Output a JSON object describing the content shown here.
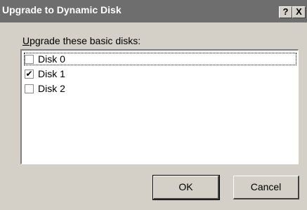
{
  "window": {
    "title": "Upgrade to Dynamic Disk",
    "help_label": "?",
    "close_label": "X"
  },
  "list": {
    "label_accel": "U",
    "label_rest": "pgrade these basic disks:",
    "items": [
      {
        "label": "Disk 0",
        "checked": false,
        "check_mark": ""
      },
      {
        "label": "Disk 1",
        "checked": true,
        "check_mark": "✔"
      },
      {
        "label": "Disk 2",
        "checked": false,
        "check_mark": ""
      }
    ]
  },
  "buttons": {
    "ok_label": "OK",
    "cancel_label": "Cancel"
  },
  "colors": {
    "titlebar": "#6e6e6e",
    "dialog_face": "#d4d0c8"
  }
}
